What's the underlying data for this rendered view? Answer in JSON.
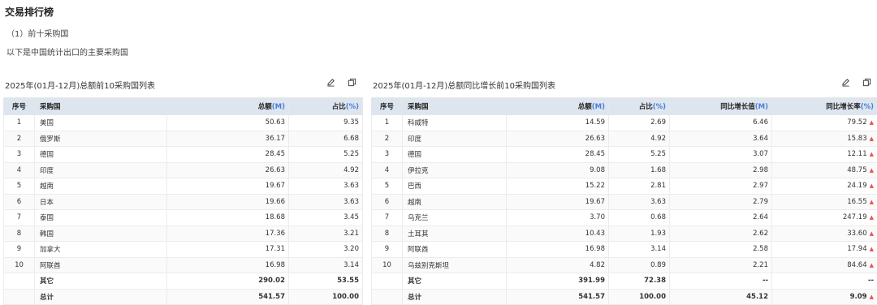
{
  "page": {
    "title": "交易排行榜",
    "line1": "（1）前十采购国",
    "line2": "以下是中国统计出口的主要采购国"
  },
  "left": {
    "title": "2025年(01月-12月)总额前10采购国列表",
    "headers": {
      "rank": "序号",
      "country": "采购国",
      "total": "总额",
      "total_unit": "(M)",
      "share": "占比",
      "share_unit": "(%)"
    },
    "rows": [
      {
        "rank": "1",
        "country": "美国",
        "total": "50.63",
        "share": "9.35"
      },
      {
        "rank": "2",
        "country": "俄罗斯",
        "total": "36.17",
        "share": "6.68"
      },
      {
        "rank": "3",
        "country": "德国",
        "total": "28.45",
        "share": "5.25"
      },
      {
        "rank": "4",
        "country": "印度",
        "total": "26.63",
        "share": "4.92"
      },
      {
        "rank": "5",
        "country": "越南",
        "total": "19.67",
        "share": "3.63"
      },
      {
        "rank": "6",
        "country": "日本",
        "total": "19.66",
        "share": "3.63"
      },
      {
        "rank": "7",
        "country": "泰国",
        "total": "18.68",
        "share": "3.45"
      },
      {
        "rank": "8",
        "country": "韩国",
        "total": "17.36",
        "share": "3.21"
      },
      {
        "rank": "9",
        "country": "加拿大",
        "total": "17.31",
        "share": "3.20"
      },
      {
        "rank": "10",
        "country": "阿联酋",
        "total": "16.98",
        "share": "3.14"
      }
    ],
    "other": {
      "label": "其它",
      "total": "290.02",
      "share": "53.55"
    },
    "sum": {
      "label": "总计",
      "total": "541.57",
      "share": "100.00"
    }
  },
  "right": {
    "title": "2025年(01月-12月)总额同比增长前10采购国列表",
    "headers": {
      "rank": "序号",
      "country": "采购国",
      "total": "总额",
      "total_unit": "(M)",
      "share": "占比",
      "share_unit": "(%)",
      "growth": "同比增长值",
      "growth_unit": "(M)",
      "rate": "同比增长率",
      "rate_unit": "(%)"
    },
    "rows": [
      {
        "rank": "1",
        "country": "科威特",
        "total": "14.59",
        "share": "2.69",
        "growth": "6.46",
        "rate": "79.52"
      },
      {
        "rank": "2",
        "country": "印度",
        "total": "26.63",
        "share": "4.92",
        "growth": "3.64",
        "rate": "15.83"
      },
      {
        "rank": "3",
        "country": "德国",
        "total": "28.45",
        "share": "5.25",
        "growth": "3.07",
        "rate": "12.11"
      },
      {
        "rank": "4",
        "country": "伊拉克",
        "total": "9.08",
        "share": "1.68",
        "growth": "2.98",
        "rate": "48.75"
      },
      {
        "rank": "5",
        "country": "巴西",
        "total": "15.22",
        "share": "2.81",
        "growth": "2.97",
        "rate": "24.19"
      },
      {
        "rank": "6",
        "country": "越南",
        "total": "19.67",
        "share": "3.63",
        "growth": "2.79",
        "rate": "16.55"
      },
      {
        "rank": "7",
        "country": "乌克兰",
        "total": "3.70",
        "share": "0.68",
        "growth": "2.64",
        "rate": "247.19"
      },
      {
        "rank": "8",
        "country": "土耳其",
        "total": "10.43",
        "share": "1.93",
        "growth": "2.62",
        "rate": "33.60"
      },
      {
        "rank": "9",
        "country": "阿联酋",
        "total": "16.98",
        "share": "3.14",
        "growth": "2.58",
        "rate": "17.94"
      },
      {
        "rank": "10",
        "country": "乌兹别克斯坦",
        "total": "4.82",
        "share": "0.89",
        "growth": "2.21",
        "rate": "84.64"
      }
    ],
    "other": {
      "label": "其它",
      "total": "391.99",
      "share": "72.38",
      "growth": "--",
      "rate": "--"
    },
    "sum": {
      "label": "总计",
      "total": "541.57",
      "share": "100.00",
      "growth": "45.12",
      "rate": "9.09"
    }
  },
  "colors": {
    "header_bg": "#dde5ef",
    "unit": "#4a7fd4",
    "up_arrow": "#e25555"
  },
  "icons": {
    "edit": "edit-icon",
    "copy": "copy-icon",
    "up": "up-arrow-icon"
  }
}
